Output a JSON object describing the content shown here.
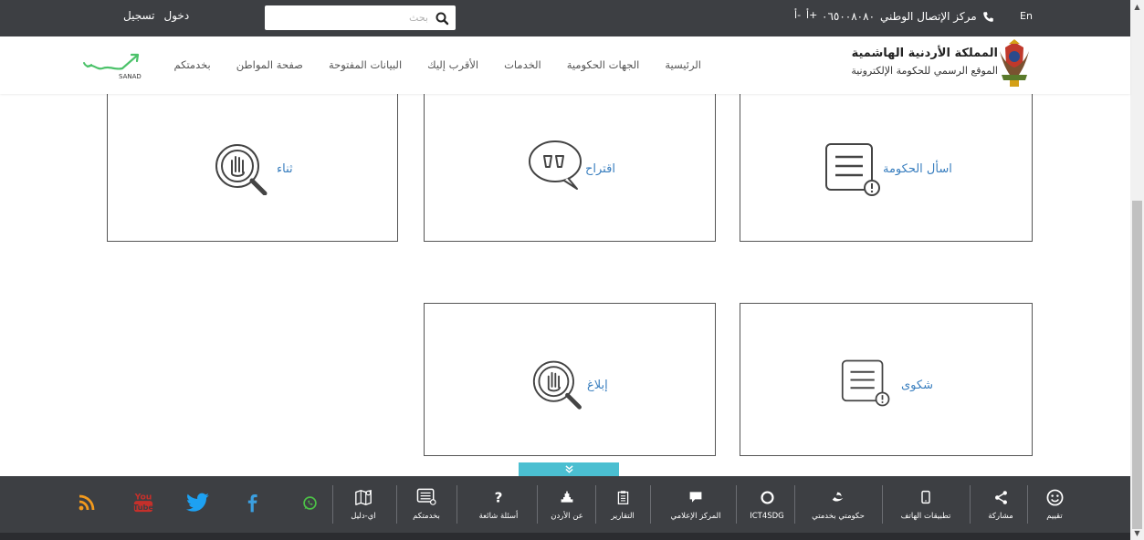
{
  "topbar": {
    "login_label": "دخول",
    "register_label": "تسجيل",
    "search_placeholder": "بحث",
    "font_increase": "أ+",
    "font_decrease": "أ-",
    "call_center_label": "مركز الإتصال الوطني",
    "call_center_number": "٠٦٥٠٠٨٠٨٠",
    "lang_label": "En"
  },
  "header": {
    "brand_title": "المملكة الأردنية الهاشمية",
    "brand_subtitle": "الموقع الرسمي للحكومة الإلكترونية",
    "nav": [
      "الرئيسية",
      "الجهات الحكومية",
      "الخدمات",
      "الأقرب إليك",
      "البيانات المفتوحة",
      "صفحة المواطن",
      "بخدمتكم"
    ],
    "sanad_label": "SANAD"
  },
  "cards": {
    "ask_government": "اسأل الحكومة",
    "suggestion": "اقتراح",
    "praise": "ثناء",
    "complaint": "شكوى",
    "report": "إبلاغ"
  },
  "footer": {
    "toggle_icon": "double-chevron-down-icon",
    "items": [
      {
        "label": "تقييم",
        "icon": "smiley-icon"
      },
      {
        "label": "مشاركة",
        "icon": "share-icon"
      },
      {
        "label": "تطبيقات الهاتف",
        "icon": "mobile-icon"
      },
      {
        "label": "حكومتي بخدمتي",
        "icon": "hukumati-logo-icon"
      },
      {
        "label": "ICT4SDG",
        "icon": "circle-icon"
      },
      {
        "label": "المركز الإعلامي",
        "icon": "chat-icon"
      },
      {
        "label": "التقارير",
        "icon": "document-icon"
      },
      {
        "label": "عن الأردن",
        "icon": "landmark-icon"
      },
      {
        "label": "أسئلة شائعة",
        "icon": "question-icon"
      },
      {
        "label": "بخدمتكم",
        "icon": "form-icon"
      },
      {
        "label": "اي-دليل",
        "icon": "map-icon"
      }
    ],
    "social": [
      "whatsapp-icon",
      "facebook-icon",
      "twitter-icon",
      "youtube-icon",
      "rss-icon"
    ],
    "youtube_text_top": "You",
    "youtube_text_bottom": "Tube"
  },
  "colors": {
    "topbar": "#3d3f43",
    "card_label": "#3a7fbf",
    "toggle_tab": "#4bbfd1",
    "youtube": "#c4302b",
    "twitter": "#1da1f2",
    "facebook": "#3b9fe0",
    "whatsapp": "#4cc247",
    "rss": "#f39a1d"
  }
}
